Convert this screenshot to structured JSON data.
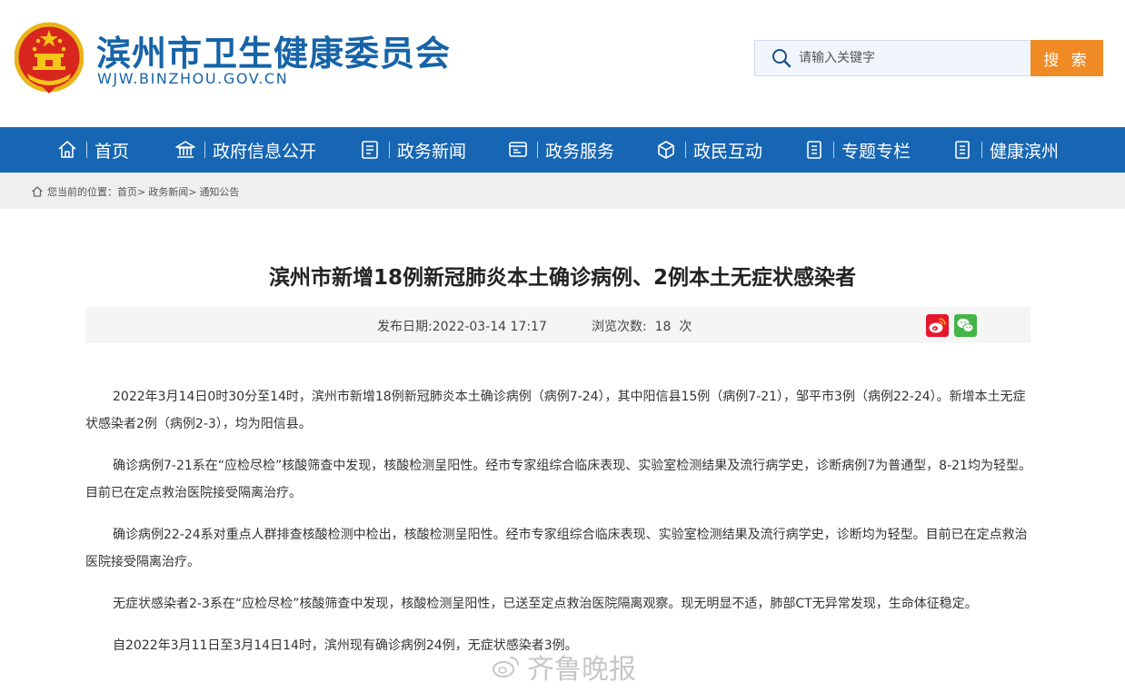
{
  "header": {
    "title": "滨州市卫生健康委员会",
    "domain": "WJW.BINZHOU.GOV.CN",
    "search_placeholder": "请输入关键字",
    "search_button": "搜 索"
  },
  "colors": {
    "brand": "#1663a8",
    "nav": "#1766b3",
    "accent": "#f08a24",
    "weibo": "#e6162d",
    "wechat": "#44b549"
  },
  "nav": {
    "items": [
      {
        "label": "首页",
        "icon": "home-icon"
      },
      {
        "label": "政府信息公开",
        "icon": "government-building-icon"
      },
      {
        "label": "政务新闻",
        "icon": "news-document-icon"
      },
      {
        "label": "政务服务",
        "icon": "service-window-icon"
      },
      {
        "label": "政民互动",
        "icon": "interaction-icon"
      },
      {
        "label": "专题专栏",
        "icon": "topic-list-icon"
      },
      {
        "label": "健康滨州",
        "icon": "health-list-icon"
      }
    ]
  },
  "breadcrumb": {
    "prefix": "您当前的位置：",
    "items": [
      "首页",
      "政务新闻",
      "通知公告"
    ],
    "separator": ">"
  },
  "article": {
    "title": "滨州市新增18例新冠肺炎本土确诊病例、2例本土无症状感染者",
    "publish": "发布日期:2022-03-14 17:17",
    "views": "浏览次数:  18  次",
    "paragraphs": [
      "2022年3月14日0时30分至14时，滨州市新增18例新冠肺炎本土确诊病例（病例7-24），其中阳信县15例（病例7-21），邹平市3例（病例22-24）。新增本土无症状感染者2例（病例2-3），均为阳信县。",
      "确诊病例7-21系在“应检尽检”核酸筛查中发现，核酸检测呈阳性。经市专家组综合临床表现、实验室检测结果及流行病学史，诊断病例7为普通型，8-21均为轻型。目前已在定点救治医院接受隔离治疗。",
      "确诊病例22-24系对重点人群排查核酸检测中检出，核酸检测呈阳性。经市专家组综合临床表现、实验室检测结果及流行病学史，诊断均为轻型。目前已在定点救治医院接受隔离治疗。",
      "无症状感染者2-3系在“应检尽检”核酸筛查中发现，核酸检测呈阳性，已送至定点救治医院隔离观察。现无明显不适，肺部CT无异常发现，生命体征稳定。",
      "自2022年3月11日至3月14日14时，滨州现有确诊病例24例，无症状感染者3例。"
    ]
  },
  "watermark": {
    "text": "齐鲁晚报"
  }
}
